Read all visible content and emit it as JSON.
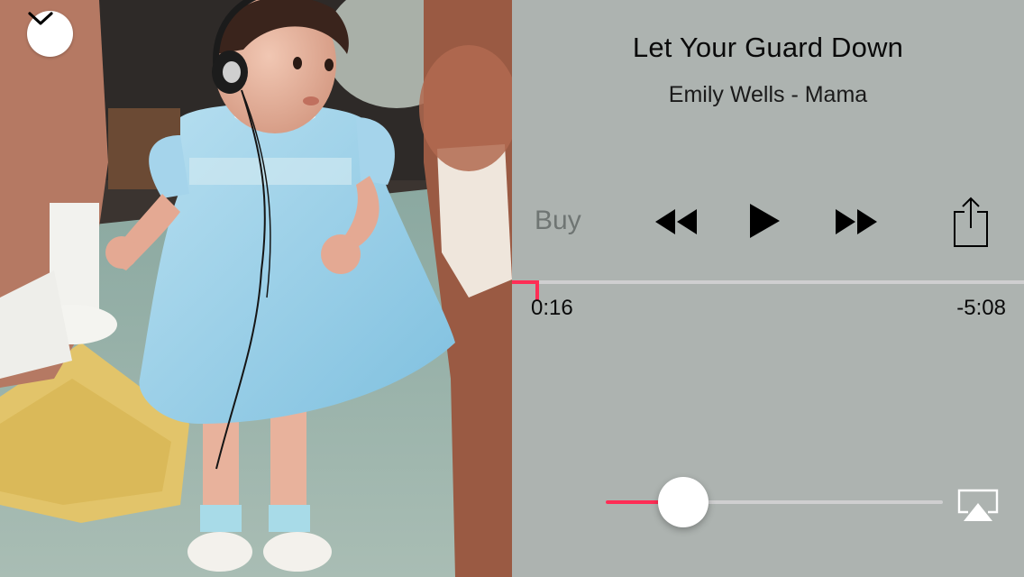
{
  "now_playing": {
    "title": "Let Your Guard Down",
    "subtitle": "Emily Wells - Mama",
    "elapsed": "0:16",
    "remaining": "-5:08",
    "progress_fraction": 0.05
  },
  "controls": {
    "buy_label": "Buy"
  },
  "volume": {
    "level_fraction": 0.22
  },
  "icons": {
    "collapse": "chevron-down-icon",
    "rewind": "rewind-icon",
    "play": "play-icon",
    "fast_forward": "fast-forward-icon",
    "share": "share-icon",
    "airplay": "airplay-icon"
  },
  "colors": {
    "accent": "#ff2d55",
    "panel_background": "#adb3b0",
    "track_inactive": "#cfcfd0"
  }
}
